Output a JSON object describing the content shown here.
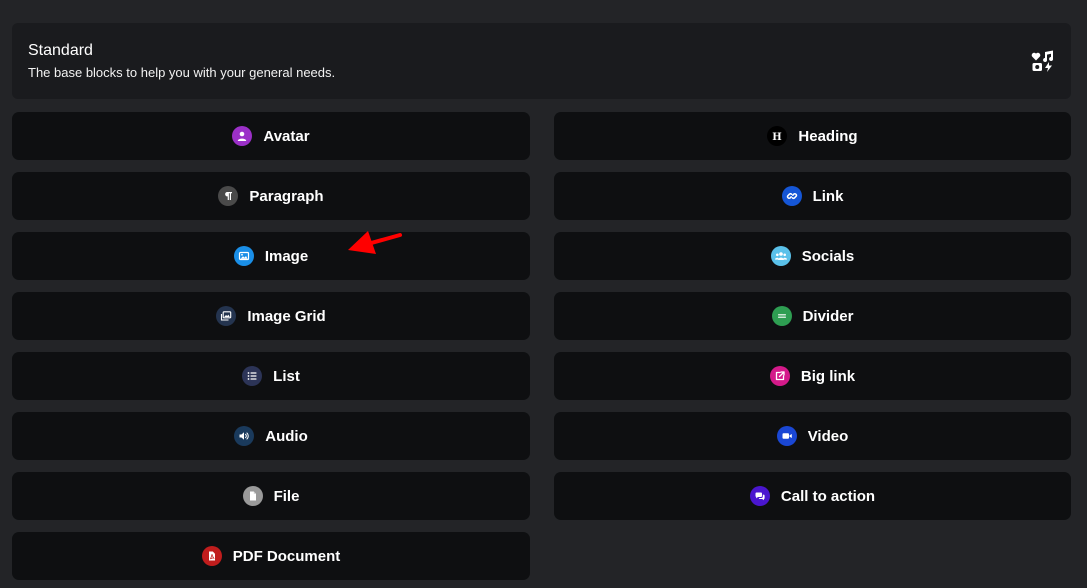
{
  "header": {
    "title": "Standard",
    "description": "The base blocks to help you with your general needs."
  },
  "blocks": [
    {
      "label": "Avatar",
      "icon": "user-icon",
      "color": "#9b30c8"
    },
    {
      "label": "Heading",
      "icon": "heading-icon",
      "color": "#000000"
    },
    {
      "label": "Paragraph",
      "icon": "paragraph-icon",
      "color": "#4a4a4a"
    },
    {
      "label": "Link",
      "icon": "link-icon",
      "color": "#1556d6"
    },
    {
      "label": "Image",
      "icon": "image-icon",
      "color": "#1a8fe8"
    },
    {
      "label": "Socials",
      "icon": "users-icon",
      "color": "#5ac1ea"
    },
    {
      "label": "Image Grid",
      "icon": "images-icon",
      "color": "#24344f"
    },
    {
      "label": "Divider",
      "icon": "divider-icon",
      "color": "#2e9e52"
    },
    {
      "label": "List",
      "icon": "list-icon",
      "color": "#2c3457"
    },
    {
      "label": "Big link",
      "icon": "external-link-icon",
      "color": "#d41a8a"
    },
    {
      "label": "Audio",
      "icon": "volume-icon",
      "color": "#1a3a5c"
    },
    {
      "label": "Video",
      "icon": "video-icon",
      "color": "#1a47d4"
    },
    {
      "label": "File",
      "icon": "file-icon",
      "color": "#9a9a9a"
    },
    {
      "label": "Call to action",
      "icon": "comments-icon",
      "color": "#4a16cf"
    },
    {
      "label": "PDF Document",
      "icon": "file-pdf-icon",
      "color": "#c01d1d"
    }
  ],
  "annotation": {
    "icon": "red-arrow-icon",
    "color": "#ff0000"
  }
}
